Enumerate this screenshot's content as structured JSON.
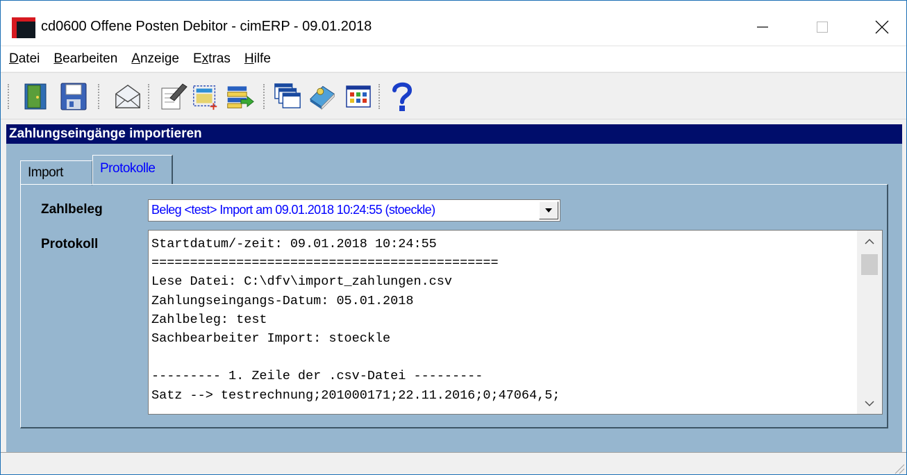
{
  "window": {
    "title": "cd0600 Offene Posten Debitor - cimERP - 09.01.2018",
    "colors": {
      "accent": "#000d6b",
      "panel": "#96b6cf",
      "link": "#0000ff"
    }
  },
  "menu": {
    "items": [
      {
        "accel": "D",
        "rest": "atei"
      },
      {
        "accel": "B",
        "rest": "earbeiten"
      },
      {
        "accel": "A",
        "rest": "nzeige"
      },
      {
        "pre": "E",
        "accel": "x",
        "rest": "tras"
      },
      {
        "accel": "H",
        "rest": "ilfe"
      }
    ]
  },
  "toolbar": {
    "icons": [
      "exit-door-icon",
      "save-disk-icon",
      "envelope-icon",
      "edit-notepad-icon",
      "new-record-icon",
      "import-list-icon",
      "windows-cascade-icon",
      "address-book-icon",
      "table-grid-icon",
      "help-question-icon"
    ]
  },
  "section": {
    "title": "Zahlungseingänge importieren"
  },
  "tabs": [
    {
      "label": "Import",
      "active": false
    },
    {
      "label": "Protokolle",
      "active": true
    }
  ],
  "form": {
    "zahlbeleg_label": "Zahlbeleg",
    "zahlbeleg_value": "Beleg <test> Import am 09.01.2018 10:24:55 (stoeckle)",
    "protokoll_label": "Protokoll"
  },
  "protokoll_lines": [
    "Startdatum/-zeit: 09.01.2018 10:24:55",
    "=============================================",
    "Lese Datei: C:\\dfv\\import_zahlungen.csv",
    "Zahlungseingangs-Datum: 05.01.2018",
    "Zahlbeleg: test",
    "Sachbearbeiter Import: stoeckle",
    "",
    "--------- 1. Zeile der .csv-Datei ---------",
    "Satz --> testrechnung;201000171;22.11.2016;0;47064,5;"
  ]
}
